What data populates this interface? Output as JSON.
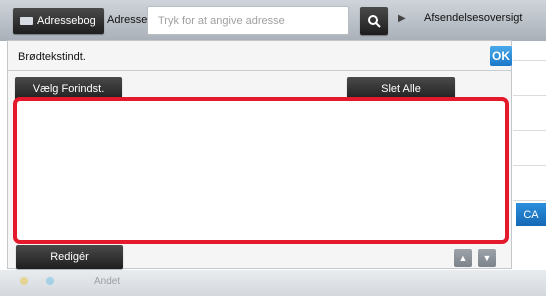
{
  "topbar": {
    "address_book_label": "Adressebog",
    "address_label": "Adresse",
    "address_placeholder": "Tryk for at angive adresse",
    "send_overview_label": "Afsendelsesoversigt"
  },
  "dialog": {
    "title": "Brødtekstindt.",
    "ok_label": "OK",
    "select_preset_label": "Vælg Forindst.",
    "delete_all_label": "Slet Alle",
    "body_text": "",
    "edit_label": "Redigér",
    "up_symbol": "▲",
    "down_symbol": "▼"
  },
  "side": {
    "ca_label": "CA"
  },
  "bottom": {
    "other_label": "Andet"
  },
  "icons": {
    "address_book": "address-book-icon",
    "search": "search-icon",
    "send_overview": "play-arrow-icon"
  },
  "colors": {
    "highlight_border": "#e5192c",
    "ok_button": "#1b78c8",
    "ca_button": "#1668b5"
  }
}
